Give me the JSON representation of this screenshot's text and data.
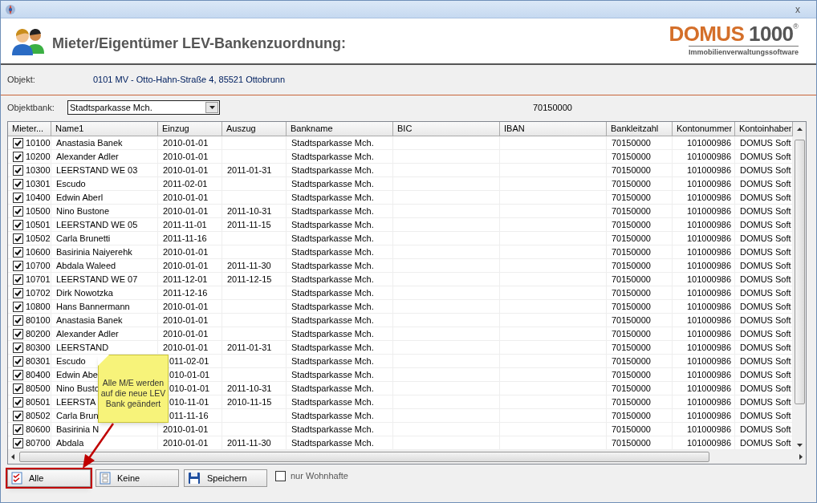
{
  "window": {
    "close": "x"
  },
  "header": {
    "title": "Mieter/Eigentümer LEV-Bankenzuordnung:",
    "logo": {
      "name": "DOMUS",
      "number": "1000",
      "mark": "®",
      "tagline": "Immobilienverwaltungssoftware"
    }
  },
  "objekt": {
    "label": "Objekt:",
    "value": "0101 MV - Otto-Hahn-Straße 4, 85521 Ottobrunn"
  },
  "objektbank": {
    "label": "Objektbank:",
    "value": "Stadtsparkasse Mch.",
    "blz": "70150000"
  },
  "table": {
    "columns": [
      "Mieter...",
      "Name1",
      "Einzug",
      "Auszug",
      "Bankname",
      "BIC",
      "IBAN",
      "Bankleitzahl",
      "Kontonummer",
      "Kontoinhaber"
    ],
    "rows": [
      {
        "checked": true,
        "mieter": "10100",
        "name1": "Anastasia Banek",
        "einzug": "2010-01-01",
        "bankname": "Stadtsparkasse Mch.",
        "bankleitzahl": "70150000",
        "kontonummer": "101000986",
        "kontoinhaber": "DOMUS Soft"
      },
      {
        "checked": true,
        "mieter": "10200",
        "name1": "Alexander Adler",
        "einzug": "2010-01-01",
        "bankname": "Stadtsparkasse Mch.",
        "bankleitzahl": "70150000",
        "kontonummer": "101000986",
        "kontoinhaber": "DOMUS Soft"
      },
      {
        "checked": true,
        "mieter": "10300",
        "name1": "LEERSTAND WE 03",
        "einzug": "2010-01-01",
        "auszug": "2011-01-31",
        "bankname": "Stadtsparkasse Mch.",
        "bankleitzahl": "70150000",
        "kontonummer": "101000986",
        "kontoinhaber": "DOMUS Soft"
      },
      {
        "checked": true,
        "mieter": "10301",
        "name1": "Escudo",
        "einzug": "2011-02-01",
        "bankname": "Stadtsparkasse Mch.",
        "bankleitzahl": "70150000",
        "kontonummer": "101000986",
        "kontoinhaber": "DOMUS Soft"
      },
      {
        "checked": true,
        "mieter": "10400",
        "name1": "Edwin Aberl",
        "einzug": "2010-01-01",
        "bankname": "Stadtsparkasse Mch.",
        "bankleitzahl": "70150000",
        "kontonummer": "101000986",
        "kontoinhaber": "DOMUS Soft"
      },
      {
        "checked": true,
        "mieter": "10500",
        "name1": "Nino Bustone",
        "einzug": "2010-01-01",
        "auszug": "2011-10-31",
        "bankname": "Stadtsparkasse Mch.",
        "bankleitzahl": "70150000",
        "kontonummer": "101000986",
        "kontoinhaber": "DOMUS Soft"
      },
      {
        "checked": true,
        "mieter": "10501",
        "name1": "LEERSTAND WE 05",
        "einzug": "2011-11-01",
        "auszug": "2011-11-15",
        "bankname": "Stadtsparkasse Mch.",
        "bankleitzahl": "70150000",
        "kontonummer": "101000986",
        "kontoinhaber": "DOMUS Soft"
      },
      {
        "checked": true,
        "mieter": "10502",
        "name1": "Carla Brunetti",
        "einzug": "2011-11-16",
        "bankname": "Stadtsparkasse Mch.",
        "bankleitzahl": "70150000",
        "kontonummer": "101000986",
        "kontoinhaber": "DOMUS Soft"
      },
      {
        "checked": true,
        "mieter": "10600",
        "name1": "Basirinia Naiyerehk",
        "einzug": "2010-01-01",
        "bankname": "Stadtsparkasse Mch.",
        "bankleitzahl": "70150000",
        "kontonummer": "101000986",
        "kontoinhaber": "DOMUS Soft"
      },
      {
        "checked": true,
        "mieter": "10700",
        "name1": "Abdala Waleed",
        "einzug": "2010-01-01",
        "auszug": "2011-11-30",
        "bankname": "Stadtsparkasse Mch.",
        "bankleitzahl": "70150000",
        "kontonummer": "101000986",
        "kontoinhaber": "DOMUS Soft"
      },
      {
        "checked": true,
        "mieter": "10701",
        "name1": "LEERSTAND WE 07",
        "einzug": "2011-12-01",
        "auszug": "2011-12-15",
        "bankname": "Stadtsparkasse Mch.",
        "bankleitzahl": "70150000",
        "kontonummer": "101000986",
        "kontoinhaber": "DOMUS Soft"
      },
      {
        "checked": true,
        "mieter": "10702",
        "name1": "Dirk Nowotzka",
        "einzug": "2011-12-16",
        "bankname": "Stadtsparkasse Mch.",
        "bankleitzahl": "70150000",
        "kontonummer": "101000986",
        "kontoinhaber": "DOMUS Soft"
      },
      {
        "checked": true,
        "mieter": "10800",
        "name1": "Hans Bannermann",
        "einzug": "2010-01-01",
        "bankname": "Stadtsparkasse Mch.",
        "bankleitzahl": "70150000",
        "kontonummer": "101000986",
        "kontoinhaber": "DOMUS Soft"
      },
      {
        "checked": true,
        "mieter": "80100",
        "name1": "Anastasia Banek",
        "einzug": "2010-01-01",
        "bankname": "Stadtsparkasse Mch.",
        "bankleitzahl": "70150000",
        "kontonummer": "101000986",
        "kontoinhaber": "DOMUS Soft"
      },
      {
        "checked": true,
        "mieter": "80200",
        "name1": "Alexander Adler",
        "einzug": "2010-01-01",
        "bankname": "Stadtsparkasse Mch.",
        "bankleitzahl": "70150000",
        "kontonummer": "101000986",
        "kontoinhaber": "DOMUS Soft"
      },
      {
        "checked": true,
        "mieter": "80300",
        "name1": "LEERSTAND",
        "einzug": "2010-01-01",
        "auszug": "2011-01-31",
        "bankname": "Stadtsparkasse Mch.",
        "bankleitzahl": "70150000",
        "kontonummer": "101000986",
        "kontoinhaber": "DOMUS Soft"
      },
      {
        "checked": true,
        "covered": true,
        "mieter": "80301",
        "name1": "Escudo",
        "einzug": "011-02-01",
        "bankname": "Stadtsparkasse Mch.",
        "bankleitzahl": "70150000",
        "kontonummer": "101000986",
        "kontoinhaber": "DOMUS Soft"
      },
      {
        "checked": true,
        "covered": true,
        "mieter": "80400",
        "name1": "Edwin Abe",
        "einzug": "010-01-01",
        "bankname": "Stadtsparkasse Mch.",
        "bankleitzahl": "70150000",
        "kontonummer": "101000986",
        "kontoinhaber": "DOMUS Soft"
      },
      {
        "checked": true,
        "covered": true,
        "mieter": "80500",
        "name1": "Nino Busto",
        "einzug": "010-01-01",
        "auszug": "2011-10-31",
        "bankname": "Stadtsparkasse Mch.",
        "bankleitzahl": "70150000",
        "kontonummer": "101000986",
        "kontoinhaber": "DOMUS Soft"
      },
      {
        "checked": true,
        "covered": true,
        "mieter": "80501",
        "name1": "LEERSTA",
        "einzug": "010-11-01",
        "auszug": "2010-11-15",
        "bankname": "Stadtsparkasse Mch.",
        "bankleitzahl": "70150000",
        "kontonummer": "101000986",
        "kontoinhaber": "DOMUS Soft"
      },
      {
        "checked": true,
        "covered": true,
        "mieter": "80502",
        "name1": "Carla Brun",
        "einzug": "011-11-16",
        "bankname": "Stadtsparkasse Mch.",
        "bankleitzahl": "70150000",
        "kontonummer": "101000986",
        "kontoinhaber": "DOMUS Soft"
      },
      {
        "checked": true,
        "mieter": "80600",
        "name1": "Basirinia N",
        "einzug": "2010-01-01",
        "bankname": "Stadtsparkasse Mch.",
        "bankleitzahl": "70150000",
        "kontonummer": "101000986",
        "kontoinhaber": "DOMUS Soft"
      },
      {
        "checked": true,
        "mieter": "80700",
        "name1": "Abdala",
        "einzug": "2010-01-01",
        "auszug": "2011-11-30",
        "bankname": "Stadtsparkasse Mch.",
        "bankleitzahl": "70150000",
        "kontonummer": "101000986",
        "kontoinhaber": "DOMUS Soft"
      }
    ]
  },
  "callout": {
    "text": "Alle M/E werden auf die neue LEV Bank geändert"
  },
  "buttons": [
    {
      "kind": "check",
      "label": "Alle",
      "highlighted": true
    },
    {
      "kind": "blank",
      "label": "Keine",
      "highlighted": false
    },
    {
      "kind": "save",
      "label": "Speichern",
      "highlighted": false
    }
  ],
  "filter": {
    "label": "nur Wohnhafte",
    "checked": false
  }
}
